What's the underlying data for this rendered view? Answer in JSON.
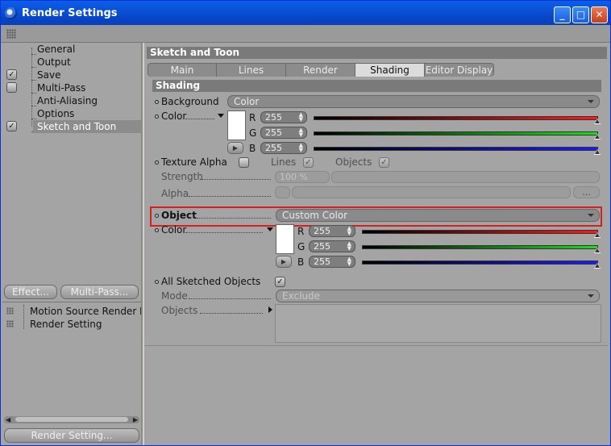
{
  "window": {
    "title": "Render Settings"
  },
  "colors": {
    "highlight": "#d42020",
    "title_bar": "#0846c8"
  },
  "tree": {
    "items": [
      {
        "label": "General",
        "checked": false
      },
      {
        "label": "Output",
        "checked": false
      },
      {
        "label": "Save",
        "checked": true
      },
      {
        "label": "Multi-Pass",
        "checked": false
      },
      {
        "label": "Anti-Aliasing",
        "checked": false
      },
      {
        "label": "Options",
        "checked": false
      },
      {
        "label": "Sketch and Toon",
        "checked": true,
        "selected": true
      }
    ]
  },
  "left_buttons": {
    "effect": "Effect...",
    "multipass": "Multi-Pass..."
  },
  "render_settings_list": [
    "Motion Source Render D",
    "Render Setting"
  ],
  "render_setting_button": "Render Setting...",
  "panel": {
    "title": "Sketch and Toon",
    "tabs": [
      "Main",
      "Lines",
      "Render",
      "Shading",
      "Editor Display"
    ],
    "active_tab": "Shading",
    "section": "Shading",
    "background": {
      "label": "Background",
      "value": "Color"
    },
    "color1": {
      "label": "Color",
      "r": "255",
      "g": "255",
      "b": "255"
    },
    "texture_alpha": {
      "label": "Texture Alpha",
      "lines": "Lines",
      "objects": "Objects"
    },
    "strength": {
      "label": "Strength",
      "value": "100 %"
    },
    "alpha": {
      "label": "Alpha",
      "button": "..."
    },
    "object": {
      "label": "Object",
      "value": "Custom Color"
    },
    "color2": {
      "label": "Color",
      "r": "255",
      "g": "255",
      "b": "255"
    },
    "all_sketched": {
      "label": "All Sketched Objects"
    },
    "mode": {
      "label": "Mode",
      "value": "Exclude"
    },
    "objects": {
      "label": "Objects"
    }
  },
  "rgb_labels": {
    "r": "R",
    "g": "G",
    "b": "B"
  }
}
